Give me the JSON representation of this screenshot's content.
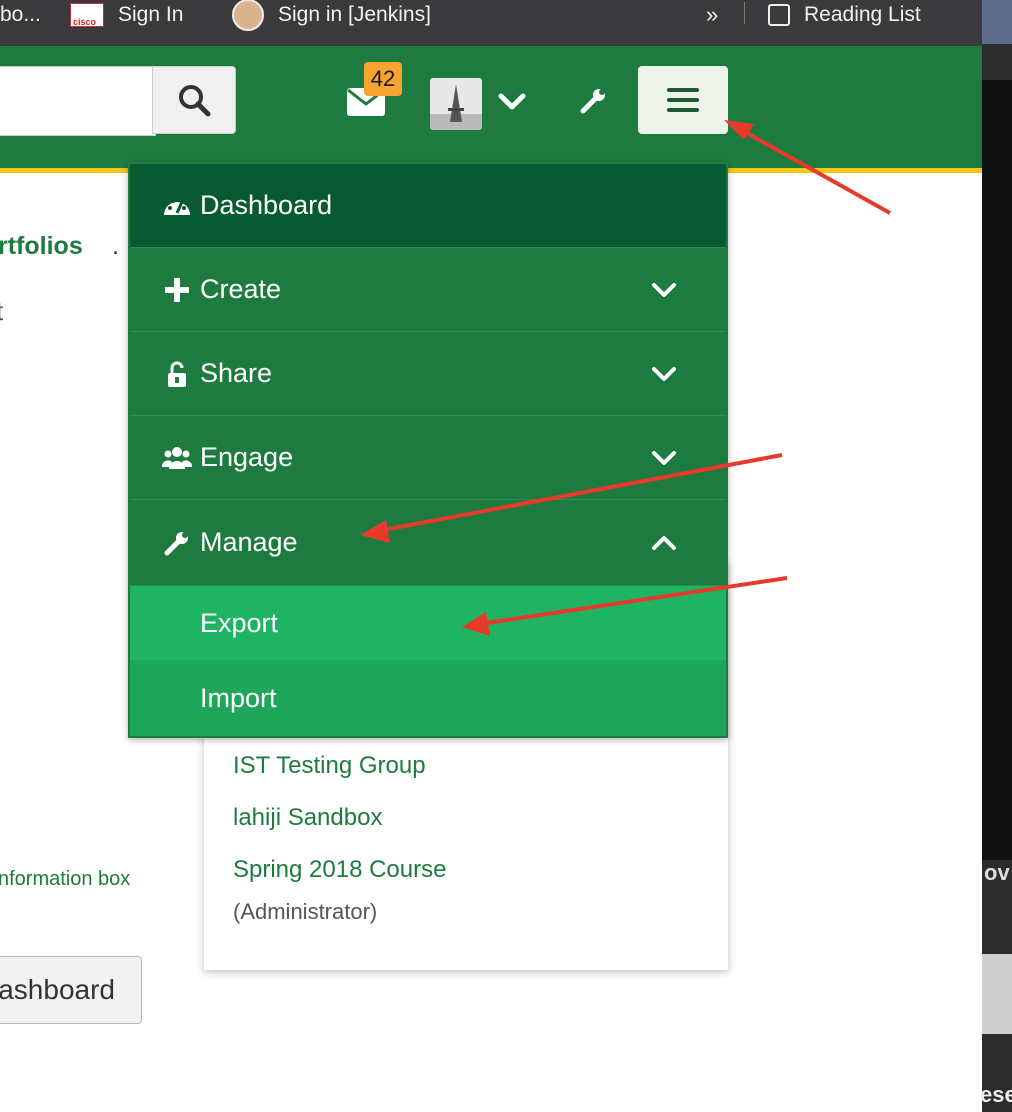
{
  "bookmarks": {
    "truncated_label": "bo...",
    "items": [
      "Sign In",
      "Sign in [Jenkins]"
    ],
    "more": "»",
    "reading_list": "Reading List"
  },
  "header": {
    "mail_badge": "42",
    "accent_color": "#1e7b3f",
    "stripe_color": "#f5c518",
    "badge_color": "#f7a331"
  },
  "page": {
    "portfolios_fragment": "rtfolios",
    "period": ".",
    "t_fragment": "t",
    "info_fragment": "nformation box",
    "dashboard_button_fragment": "ashboard"
  },
  "menu": {
    "items": [
      {
        "label": "Dashboard",
        "icon": "dashboard-icon"
      },
      {
        "label": "Create",
        "icon": "plus-icon"
      },
      {
        "label": "Share",
        "icon": "unlock-icon"
      },
      {
        "label": "Engage",
        "icon": "users-icon"
      },
      {
        "label": "Manage",
        "icon": "wrench-icon"
      }
    ],
    "manage_sub": [
      "Export",
      "Import"
    ]
  },
  "groups": {
    "items": [
      "IST Testing Group",
      "lahiji Sandbox",
      "Spring 2018 Course"
    ],
    "role": "(Administrator)"
  },
  "right_strip": {
    "ov_fragment": "ov",
    "ese_fragment": "ese"
  }
}
